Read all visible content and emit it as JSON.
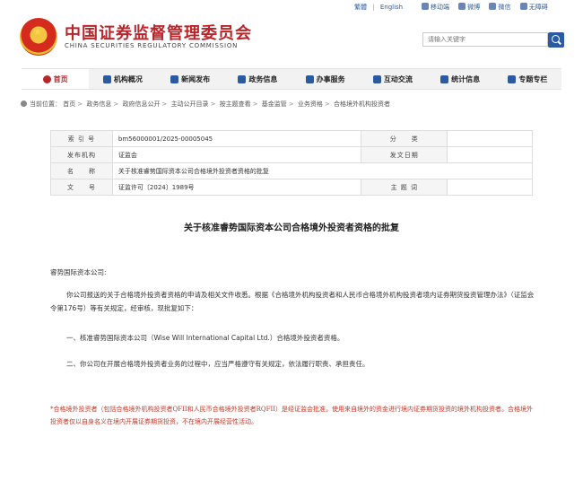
{
  "topbar": {
    "lang_traditional": "繁體",
    "lang_sep": "|",
    "lang_english": "English",
    "quick_links": [
      {
        "label": "移动端",
        "icon": "mobile-icon"
      },
      {
        "label": "微博",
        "icon": "weibo-icon"
      },
      {
        "label": "微信",
        "icon": "wechat-icon"
      },
      {
        "label": "无障碍",
        "icon": "accessibility-icon"
      }
    ]
  },
  "header": {
    "title": "中国证券监督管理委员会",
    "subtitle_en": "CHINA SECURITIES REGULATORY COMMISSION",
    "search_placeholder": "请输入关键字",
    "emblem_icon": "national-emblem-icon"
  },
  "nav": {
    "items": [
      {
        "label": "首页",
        "active": true
      },
      {
        "label": "机构概况"
      },
      {
        "label": "新闻发布"
      },
      {
        "label": "政务信息"
      },
      {
        "label": "办事服务"
      },
      {
        "label": "互动交流"
      },
      {
        "label": "统计信息"
      },
      {
        "label": "专题专栏"
      }
    ]
  },
  "breadcrumb": {
    "prefix": "当前位置：",
    "items": [
      "首页",
      "政务信息",
      "政府信息公开",
      "主动公开目录",
      "按主题查看",
      "基金监管",
      "业务资格",
      "合格境外机构投资者"
    ]
  },
  "meta": {
    "index_label": "索 引 号",
    "index_value": "bm56000001/2025-00005045",
    "category_label": "分　　类",
    "category_value": "",
    "org_label": "发布机构",
    "org_value": "证监会",
    "date_label": "发文日期",
    "date_value": "",
    "name_label": "名　　称",
    "name_value": "关于核准睿势国际资本公司合格境外投资者资格的批复",
    "docno_label": "文　　号",
    "docno_value": "证监许可〔2024〕1989号",
    "topic_label": "主 题 词",
    "topic_value": ""
  },
  "document": {
    "title": "关于核准睿势国际资本公司合格境外投资者资格的批复",
    "salutation": "睿势国际资本公司:",
    "para1": "你公司报送的关于合格境外投资者资格的申请及相关文件收悉。根据《合格境外机构投资者和人民币合格境外机构投资者境内证券期货投资管理办法》（证监会令第176号）等有关规定，经审核，现批复如下：",
    "para2": "一、核准睿势国际资本公司（Wise Will International Capital Ltd.）合格境外投资者资格。",
    "para3": "二、你公司在开展合格境外投资者业务的过程中，应当严格遵守有关规定，依法履行职责、承担责任。",
    "note": "*合格境外投资者（包括合格境外机构投资者QFII和人民币合格境外投资者RQFII）是经证监会批准，使用来自境外的资金进行境内证券期货投资的境外机构投资者。合格境外投资者仅以自身名义在境内开展证券期货投资，不在境内开展经营性活动。"
  }
}
